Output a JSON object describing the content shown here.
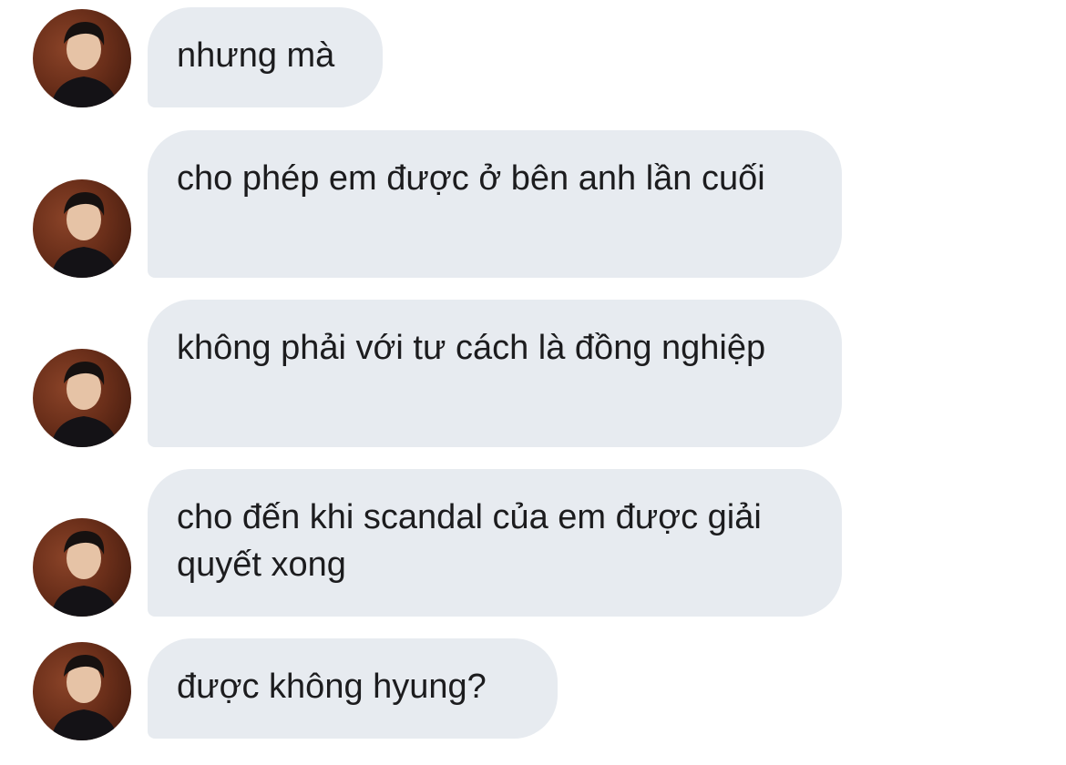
{
  "chat": {
    "messages": [
      {
        "text": "nhưng mà",
        "avatar_icon": "profile-photo-avatar"
      },
      {
        "text": "cho phép em được ở bên anh lần cuối",
        "avatar_icon": "profile-photo-avatar"
      },
      {
        "text": "không phải với tư cách là đồng nghiệp",
        "avatar_icon": "profile-photo-avatar"
      },
      {
        "text": "cho đến khi scandal của em được giải quyết xong",
        "avatar_icon": "profile-photo-avatar"
      },
      {
        "text": "được không hyung?",
        "avatar_icon": "profile-photo-avatar"
      }
    ]
  },
  "colors": {
    "bubble_background": "#e7ebf0",
    "text": "#1c1c1e",
    "page_background": "#ffffff",
    "avatar_background": "#6b2f1a"
  }
}
